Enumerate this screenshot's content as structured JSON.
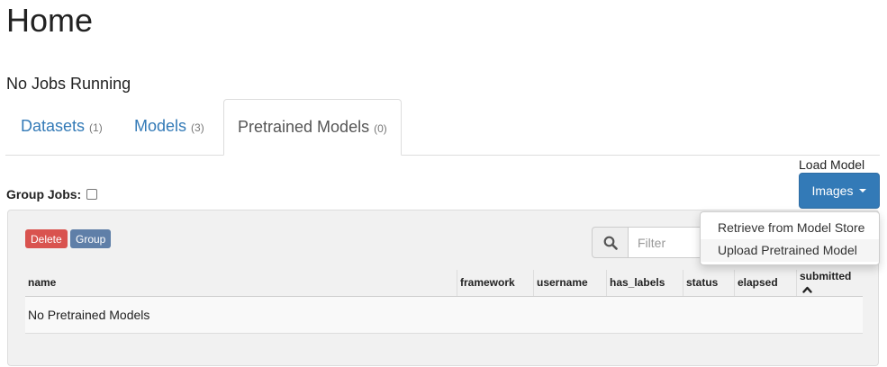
{
  "page": {
    "title": "Home",
    "jobs_status": "No Jobs Running"
  },
  "tabs": [
    {
      "label": "Datasets",
      "count": "(1)",
      "active": false
    },
    {
      "label": "Models",
      "count": "(3)",
      "active": false
    },
    {
      "label": "Pretrained Models",
      "count": "(0)",
      "active": true
    }
  ],
  "group_jobs": {
    "label": "Group Jobs:",
    "checked": false
  },
  "load_model": {
    "label": "Load Model",
    "button_label": "Images",
    "menu": [
      {
        "label": "Retrieve from Model Store"
      },
      {
        "label": "Upload Pretrained Model"
      }
    ]
  },
  "toolbar": {
    "delete_label": "Delete",
    "group_label": "Group",
    "filter_placeholder": "Filter",
    "filter_value": ""
  },
  "table": {
    "columns": [
      "name",
      "framework",
      "username",
      "has_labels",
      "status",
      "elapsed",
      "submitted"
    ],
    "empty_message": "No Pretrained Models",
    "sorted_column": "submitted"
  },
  "colors": {
    "link": "#337ab7",
    "primary_button": "#337ab7",
    "delete_button": "#d9534f",
    "group_button": "#5f7fa8",
    "panel_background": "#f1f1f1"
  },
  "icons": {
    "search": "search-icon",
    "caret": "caret-down-icon",
    "sort": "sort-up-icon"
  }
}
